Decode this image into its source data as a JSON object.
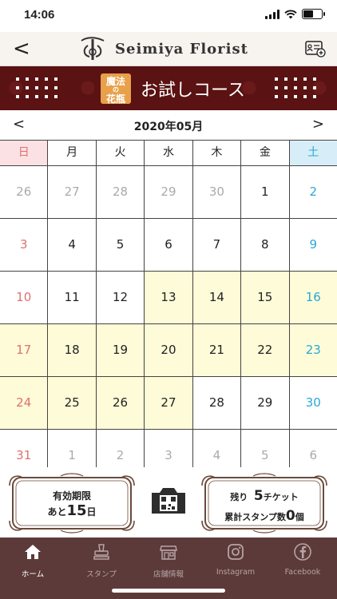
{
  "status": {
    "time": "14:06"
  },
  "header": {
    "back": "<",
    "logo_text": "Seimiya Florist"
  },
  "banner": {
    "badge_top": "魔法",
    "badge_mid": "の",
    "badge_bottom": "花瓶",
    "title": "お試しコース"
  },
  "calendar": {
    "month_title": "2020年05月",
    "prev": "<",
    "next": ">",
    "weekdays": [
      "日",
      "月",
      "火",
      "水",
      "木",
      "金",
      "土"
    ],
    "weeks": [
      [
        "26",
        "27",
        "28",
        "29",
        "30",
        "1",
        "2"
      ],
      [
        "3",
        "4",
        "5",
        "6",
        "7",
        "8",
        "9"
      ],
      [
        "10",
        "11",
        "12",
        "13",
        "14",
        "15",
        "16"
      ],
      [
        "17",
        "18",
        "19",
        "20",
        "21",
        "22",
        "23"
      ],
      [
        "24",
        "25",
        "26",
        "27",
        "28",
        "29",
        "30"
      ],
      [
        "31",
        "1",
        "2",
        "3",
        "4",
        "5",
        "6"
      ]
    ]
  },
  "expiry": {
    "label": "有効期限",
    "prefix": "あと",
    "days": "15",
    "suffix": "日"
  },
  "tickets": {
    "remaining_label": "残り",
    "remaining_count": "5",
    "remaining_unit": "チケット",
    "stamp_label": "累計スタンプ数",
    "stamp_count": "0",
    "stamp_unit": "個"
  },
  "tabs": [
    "ホーム",
    "スタンプ",
    "店舗情報",
    "Instagram",
    "Facebook"
  ],
  "colors": {
    "banner": "#5a1212",
    "tabbar": "#5c3a3a",
    "highlight": "#fdfbd8",
    "sunday": "#e07070",
    "saturday": "#2aa8d6"
  }
}
